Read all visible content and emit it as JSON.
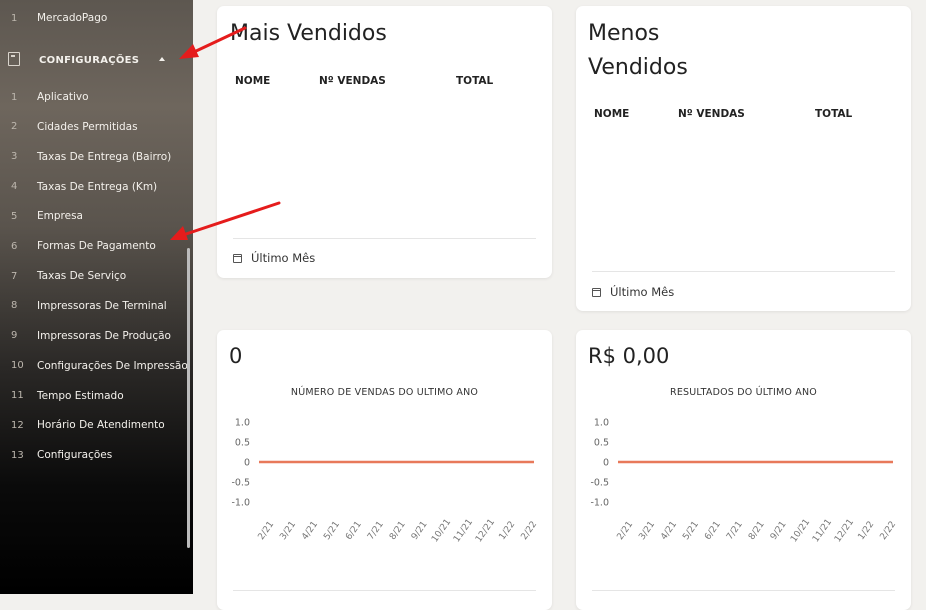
{
  "sidebar": {
    "top_item": {
      "num": "1",
      "label": "MercadoPago"
    },
    "section": {
      "label": "CONFIGURAÇÕES",
      "icon": "book-icon",
      "caret": "caret-up-icon"
    },
    "items": [
      {
        "num": "1",
        "label": "Aplicativo"
      },
      {
        "num": "2",
        "label": "Cidades Permitidas"
      },
      {
        "num": "3",
        "label": "Taxas De Entrega (Bairro)"
      },
      {
        "num": "4",
        "label": "Taxas De Entrega (Km)"
      },
      {
        "num": "5",
        "label": "Empresa"
      },
      {
        "num": "6",
        "label": "Formas De Pagamento"
      },
      {
        "num": "7",
        "label": "Taxas De Serviço"
      },
      {
        "num": "8",
        "label": "Impressoras De Terminal"
      },
      {
        "num": "9",
        "label": "Impressoras De Produção"
      },
      {
        "num": "10",
        "label": "Configurações De Impressão"
      },
      {
        "num": "11",
        "label": "Tempo Estimado"
      },
      {
        "num": "12",
        "label": "Horário De Atendimento"
      },
      {
        "num": "13",
        "label": "Configurações"
      }
    ]
  },
  "best_sellers": {
    "title": "Mais Vendidos",
    "columns": [
      "NOME",
      "Nº VENDAS",
      "TOTAL"
    ],
    "footer": "Último Mês"
  },
  "worst_sellers": {
    "title_line1": "Menos",
    "title_line2": "Vendidos",
    "columns": [
      "NOME",
      "Nº VENDAS",
      "TOTAL"
    ],
    "footer": "Último Mês"
  },
  "sales_count": {
    "value": "0",
    "chart_title": "NÚMERO DE VENDAS DO ULTIMO ANO"
  },
  "results": {
    "value": "R$ 0,00",
    "chart_title": "RESULTADOS DO ÚLTIMO ANO"
  },
  "colors": {
    "line": "#e8795a",
    "annotation_arrow": "#e51c1c"
  },
  "chart_data": [
    {
      "type": "line",
      "title": "NÚMERO DE VENDAS DO ULTIMO ANO",
      "categories": [
        "2/21",
        "3/21",
        "4/21",
        "5/21",
        "6/21",
        "7/21",
        "8/21",
        "9/21",
        "10/21",
        "11/21",
        "12/21",
        "1/22",
        "2/22"
      ],
      "series": [
        {
          "values": [
            0,
            0,
            0,
            0,
            0,
            0,
            0,
            0,
            0,
            0,
            0,
            0,
            0
          ]
        }
      ],
      "y_ticks": [
        "1.0",
        "0.5",
        "0",
        "-0.5",
        "-1.0"
      ],
      "ylim": [
        -1,
        1
      ],
      "grid": false
    },
    {
      "type": "line",
      "title": "RESULTADOS DO ÚLTIMO ANO",
      "categories": [
        "2/21",
        "3/21",
        "4/21",
        "5/21",
        "6/21",
        "7/21",
        "8/21",
        "9/21",
        "10/21",
        "11/21",
        "12/21",
        "1/22",
        "2/22"
      ],
      "series": [
        {
          "values": [
            0,
            0,
            0,
            0,
            0,
            0,
            0,
            0,
            0,
            0,
            0,
            0,
            0
          ]
        }
      ],
      "y_ticks": [
        "1.0",
        "0.5",
        "0",
        "-0.5",
        "-1.0"
      ],
      "ylim": [
        -1,
        1
      ],
      "grid": false
    }
  ]
}
